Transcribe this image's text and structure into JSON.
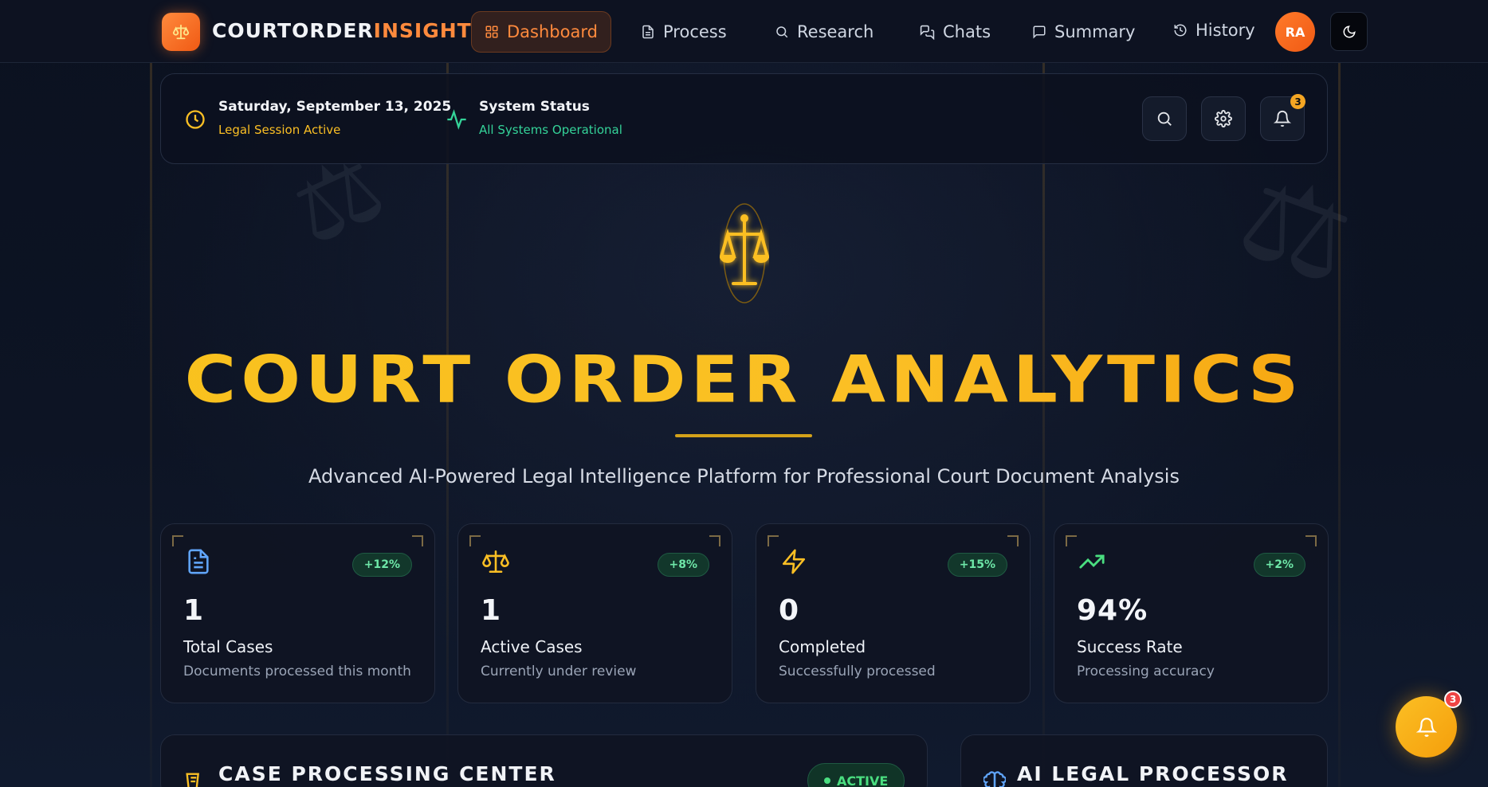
{
  "brand": {
    "part1": "COURTORDER",
    "part2": "INSIGHT"
  },
  "nav": {
    "items": [
      {
        "label": "Dashboard",
        "icon": "grid-icon",
        "active": true
      },
      {
        "label": "Process",
        "icon": "document-icon"
      },
      {
        "label": "Research",
        "icon": "search-icon"
      },
      {
        "label": "Chats",
        "icon": "chats-icon"
      },
      {
        "label": "Summary",
        "icon": "message-icon"
      },
      {
        "label": "History",
        "icon": "history-icon"
      }
    ],
    "avatar_initials": "RA"
  },
  "status": {
    "date": "Saturday, September 13, 2025",
    "session": "Legal Session Active",
    "system_title": "System Status",
    "system_sub": "All Systems Operational",
    "notifications": "3"
  },
  "hero": {
    "title": "COURT ORDER ANALYTICS",
    "subtitle": "Advanced AI-Powered Legal Intelligence Platform for Professional Court Document Analysis"
  },
  "stats": [
    {
      "value": "1",
      "label": "Total Cases",
      "desc": "Documents processed this month",
      "change": "+12%",
      "icon": "document-icon",
      "color": "#60a5fa"
    },
    {
      "value": "1",
      "label": "Active Cases",
      "desc": "Currently under review",
      "change": "+8%",
      "icon": "scales-icon",
      "color": "#fbbf24"
    },
    {
      "value": "0",
      "label": "Completed",
      "desc": "Successfully processed",
      "change": "+15%",
      "icon": "lightning-icon",
      "color": "#fbbf24"
    },
    {
      "value": "94%",
      "label": "Success Rate",
      "desc": "Processing accuracy",
      "change": "+2%",
      "icon": "trending-up-icon",
      "color": "#4ade80"
    }
  ],
  "panels": {
    "left_title": "CASE PROCESSING CENTER",
    "left_status": "ACTIVE",
    "right_title": "AI LEGAL PROCESSOR"
  },
  "fab": {
    "count": "3"
  },
  "colors": {
    "accent_orange": "#ff8a3d",
    "accent_gold": "#fbbf24",
    "success": "#4ade80",
    "bg": "#0b1120"
  }
}
